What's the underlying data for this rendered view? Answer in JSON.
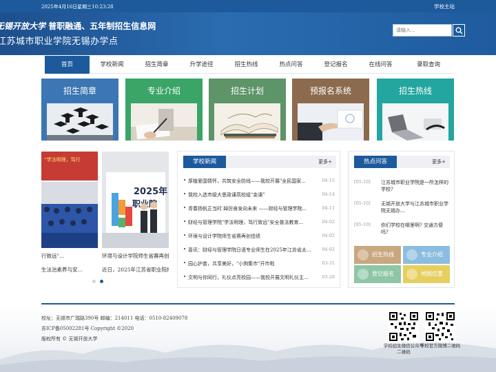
{
  "topbar": {
    "date": "2025年4月16日星期三10:23:28",
    "home_link": "学校主站"
  },
  "header": {
    "title_calligraphy": "无锡开放大学",
    "title_tagline": "普职融通、五年制招生信息网",
    "subtitle": "江苏城市职业学院无锡办学点",
    "search_placeholder": "请输入...",
    "search_icon": "search-icon"
  },
  "nav": {
    "items": [
      "首页",
      "学校新闻",
      "招生简章",
      "升学途径",
      "招生热线",
      "热点问答",
      "登记报名",
      "在线问答",
      "录取查询"
    ],
    "active": "首页"
  },
  "tiles": [
    {
      "label": "招生简章",
      "color": "#3c76b3"
    },
    {
      "label": "专业介绍",
      "color": "#3aa566"
    },
    {
      "label": "招生计划",
      "color": "#5d9468"
    },
    {
      "label": "预报名系统",
      "color": "#8b6a4e"
    },
    {
      "label": "招生热线",
      "color": "#23a5a0"
    }
  ],
  "slider": {
    "captions": [
      "行致远\"...",
      "环境与设计学院师生省赛再创",
      "生法治素养与安...",
      "近日，2025年江苏省职业院校"
    ],
    "banner_text_1": "2025年",
    "banner_text_2": "职业院",
    "dots": 2,
    "active_dot": 2
  },
  "news": {
    "tab": "学校新闻",
    "more": "更多+",
    "items": [
      {
        "title": "厚植爱国情怀，共筑安全防线——我校开展\"全民国家...",
        "date": "04-15"
      },
      {
        "title": "我校入选市级大思政课高校组\"金课\"",
        "date": "04-14"
      },
      {
        "title": "青春扬帆正当时 踔厉奋发向未来 ——财经与管理学院...",
        "date": "04-11"
      },
      {
        "title": "财经与管理学院\"学法明理，笃行致远\"安全普法教育...",
        "date": "04-02"
      },
      {
        "title": "环境与设计学院师生省赛再创佳绩",
        "date": "04-02"
      },
      {
        "title": "喜讯：财经与管理学院日语专业师生在2025年江苏省太...",
        "date": "04-02"
      },
      {
        "title": "园心护苗，共享美好，\"小狗集市\"开市啦",
        "date": "03-31"
      },
      {
        "title": "文明与你同行，礼仪点亮校园——我校开展文明礼仪主...",
        "date": "03-28"
      }
    ]
  },
  "hot": {
    "tab": "热点问答",
    "more": "更多+",
    "items": [
      {
        "date": "[05-10]",
        "q": "江苏城市职业学院是一所怎样的学校?"
      },
      {
        "date": "[05-10]",
        "q": "无锡开放大学与江苏城市职业学院无锡办..."
      },
      {
        "date": "[05-10]",
        "q": "你们学校在哪里啊? 交通方便吗?"
      }
    ],
    "buttons": [
      {
        "label": "招生热线",
        "icon": "phone-icon",
        "color": "#c9a77f"
      },
      {
        "label": "专业介绍",
        "icon": "grid-icon",
        "color": "#8cbde0"
      },
      {
        "label": "登记报名",
        "icon": "edit-icon",
        "color": "#8ec6a6"
      },
      {
        "label": "地图位置",
        "icon": "map-pin-icon",
        "color": "#e6cf5f"
      }
    ]
  },
  "footer": {
    "address": "校址：无锡市广瑞路390号   邮编：214011  电话：0510-82409078",
    "icp": "苏ICP备05002281号 Copyright ©2020",
    "copyright": "版权所有 © 无锡开放大学",
    "qr1": "学校招生微信公众号二维码",
    "qr2": "学校官方微博二维码"
  }
}
